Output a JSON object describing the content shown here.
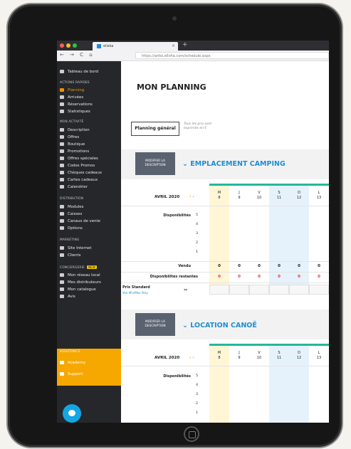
{
  "browser": {
    "tab_title": "eliska",
    "new_tab": "+",
    "url": "https://ariko.elloha.com/schedule.aspx",
    "nav_icons": "← → C ⌂"
  },
  "sidebar": {
    "top_item": "Tableau de bord",
    "sections": [
      {
        "title": "ACTIONS RAPIDES",
        "items": [
          "Planning",
          "Arrivées",
          "Réservations",
          "Statistiques"
        ]
      },
      {
        "title": "MON ACTIVITÉ",
        "items": [
          "Description",
          "Offres",
          "Boutique",
          "Promotions",
          "Offres spéciales",
          "Codes Promos",
          "Chèques cadeaux",
          "Cartes cadeaux",
          "Calendrier"
        ]
      },
      {
        "title": "DISTRIBUTION",
        "items": [
          "Modules",
          "Caisses",
          "Canaux de vente",
          "Options"
        ]
      },
      {
        "title": "MARKETING",
        "items": [
          "Site Internet",
          "Clients"
        ]
      },
      {
        "title": "CONCIERGERIE",
        "badge": "NEW",
        "items": [
          "Mon réseau local",
          "Mes distributeurs",
          "Mon catalogue",
          "Avis"
        ]
      },
      {
        "title": "ASSISTANCE",
        "items": [
          "Academy",
          "Support"
        ]
      }
    ]
  },
  "main": {
    "title": "MON PLANNING",
    "planning_button": "Planning général",
    "note": "Tous les prix sont exprimés en €",
    "blocks": [
      {
        "modify_label": "MODIFIER LA DESCRIPTION",
        "category": "EMPLACEMENT CAMPING",
        "month": "AVRIL 2020",
        "days": [
          {
            "d": "M",
            "n": "8"
          },
          {
            "d": "J",
            "n": "9"
          },
          {
            "d": "V",
            "n": "10"
          },
          {
            "d": "S",
            "n": "11"
          },
          {
            "d": "D",
            "n": "12"
          },
          {
            "d": "L",
            "n": "13"
          }
        ],
        "availability_label": "Disponibilités",
        "levels": [
          "5",
          "4",
          "3",
          "2",
          "1"
        ],
        "sold_label": "Vendu",
        "sold": [
          "0",
          "0",
          "0",
          "0",
          "0",
          "0"
        ],
        "remaining_label": "Disponibilités restantes",
        "remaining": [
          "0",
          "0",
          "0",
          "0",
          "0",
          "0"
        ],
        "price_label": "Prix Standard",
        "price_sub": "Voir Min/Max Stay"
      },
      {
        "modify_label": "MODIFIER LA DESCRIPTION",
        "category": "LOCATION CANOË",
        "month": "AVRIL 2020",
        "days": [
          {
            "d": "M",
            "n": "8"
          },
          {
            "d": "J",
            "n": "9"
          },
          {
            "d": "V",
            "n": "10"
          },
          {
            "d": "S",
            "n": "11"
          },
          {
            "d": "D",
            "n": "12"
          },
          {
            "d": "L",
            "n": "13"
          }
        ],
        "availability_label": "Disponibilités",
        "levels": [
          "5",
          "4",
          "3",
          "2",
          "1"
        ]
      }
    ]
  }
}
